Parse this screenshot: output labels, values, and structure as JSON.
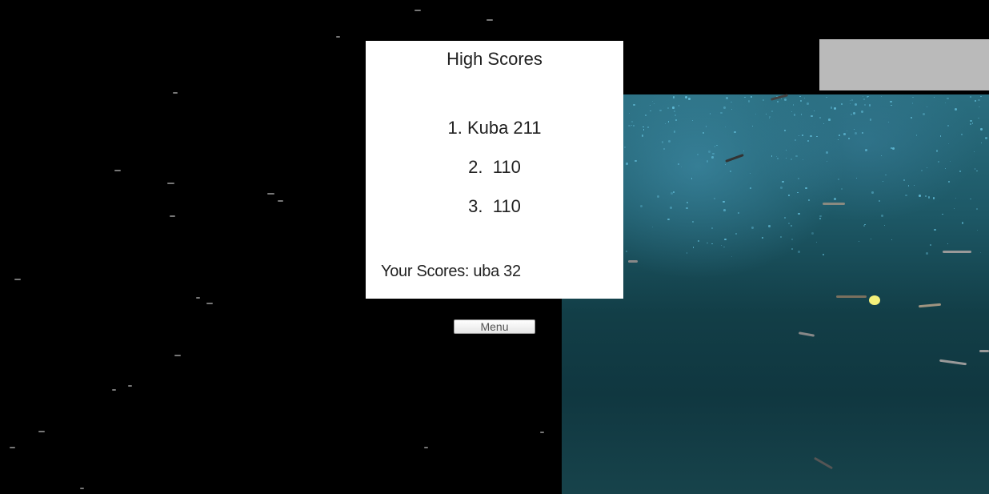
{
  "high_scores": {
    "title": "High Scores",
    "entries": [
      {
        "rank": "1.",
        "name": "Kuba",
        "score": "211",
        "text": "1. Kuba 211"
      },
      {
        "rank": "2.",
        "name": "",
        "score": "110",
        "text": "2.  110"
      },
      {
        "rank": "3.",
        "name": "",
        "score": "110",
        "text": "3.  110"
      }
    ],
    "your_scores": "Your Scores: uba 32"
  },
  "menu": {
    "label": "Menu"
  },
  "colors": {
    "background": "#000000",
    "panel": "#ffffff",
    "grey_panel": "#bababa",
    "ocean_deep": "#123e47",
    "ocean_light": "#2a6e80",
    "marker": "#f3f07a"
  },
  "icons": {
    "sun_marker": "yellow-dot-icon",
    "fish": "fish-icon"
  }
}
